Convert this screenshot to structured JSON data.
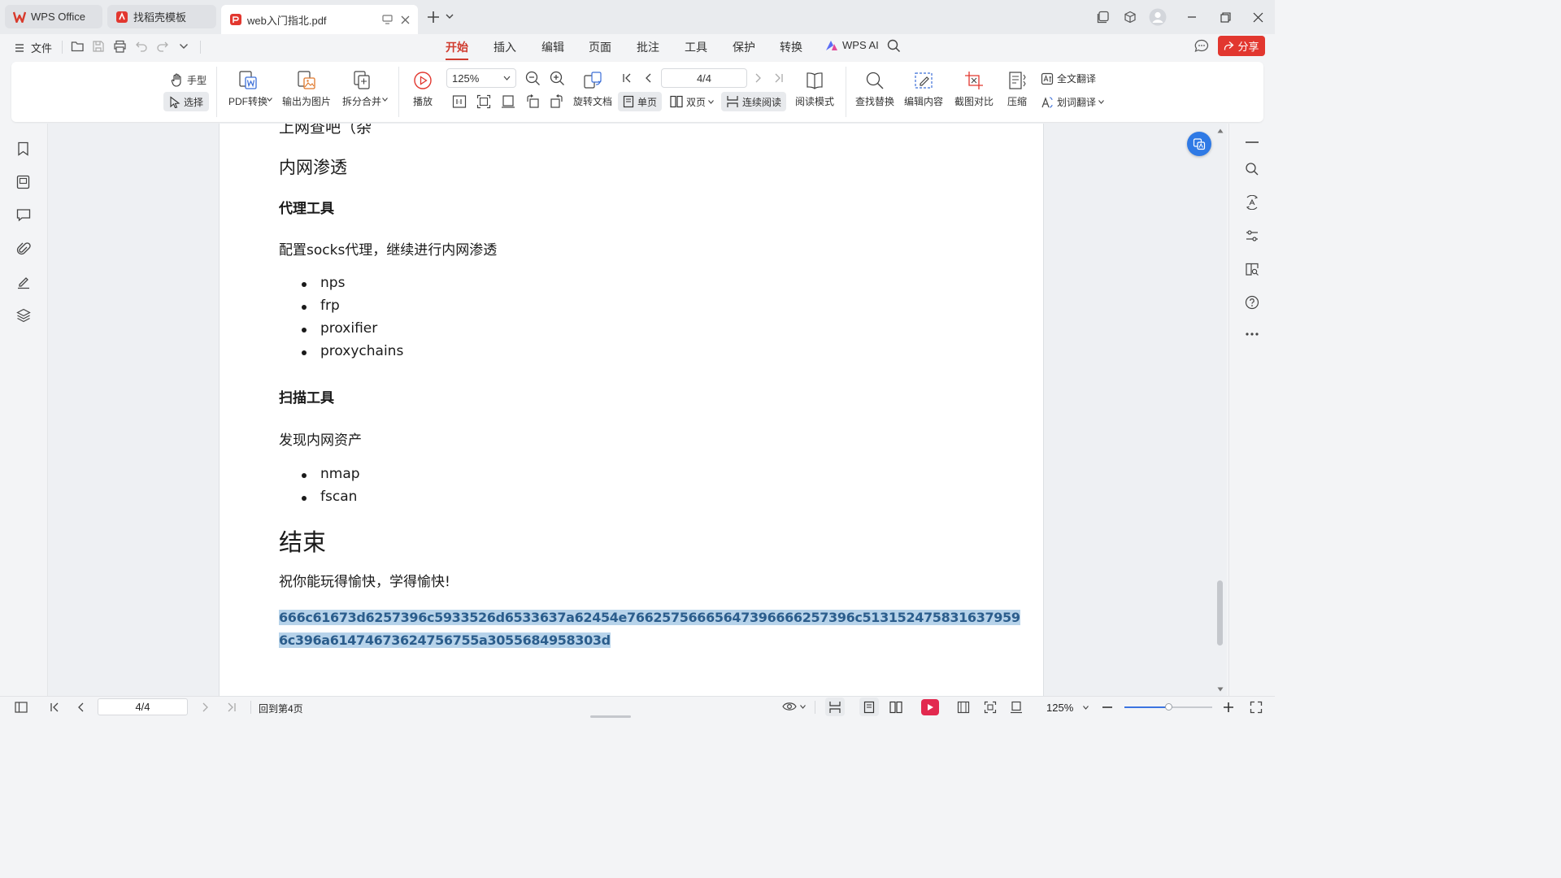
{
  "tabs": [
    {
      "label": "WPS Office"
    },
    {
      "label": "找稻壳模板"
    },
    {
      "label": "web入门指北.pdf"
    }
  ],
  "menubar": {
    "file": "文件",
    "items": [
      "开始",
      "插入",
      "编辑",
      "页面",
      "批注",
      "工具",
      "保护",
      "转换"
    ],
    "active": "开始",
    "wps_ai": "WPS AI",
    "share": "分享"
  },
  "ribbon": {
    "hand": "手型",
    "select": "选择",
    "pdf_convert": "PDF转换",
    "export_image": "输出为图片",
    "split_merge": "拆分合并",
    "play": "播放",
    "zoom": "125%",
    "page_indicator": "4/4",
    "rotate_doc": "旋转文档",
    "single_page": "单页",
    "double_page": "双页",
    "continuous_read": "连续阅读",
    "read_mode": "阅读模式",
    "find_replace": "查找替换",
    "edit_content": "编辑内容",
    "screenshot_compare": "截图对比",
    "compress": "压缩",
    "full_translate": "全文翻译",
    "word_translate": "划词翻译"
  },
  "document": {
    "partial_line": "上网查吧（杂",
    "heading_intranet": "内网渗透",
    "heading_proxy": "代理工具",
    "proxy_desc": "配置socks代理，继续进行内网渗透",
    "proxy_tools": [
      "nps",
      "frp",
      "proxifier",
      "proxychains"
    ],
    "heading_scan": "扫描工具",
    "scan_desc": "发现内网资产",
    "scan_tools": [
      "nmap",
      "fscan"
    ],
    "heading_end": "结束",
    "end_desc": "祝你能玩得愉快，学得愉快!",
    "hash_line1": "666c61673d6257396c5933526d6533637a62454e76625756665647396666257396c513152475831637959",
    "hash_line2": "6c396a61474673624756755a3055684958303d"
  },
  "statusbar": {
    "page_field": "4/4",
    "back_to_page": "回到第4页",
    "zoom": "125%"
  },
  "colors": {
    "accent_red": "#d03b2e",
    "share_bg": "#e2372f",
    "highlight": "#b7d3ea"
  }
}
